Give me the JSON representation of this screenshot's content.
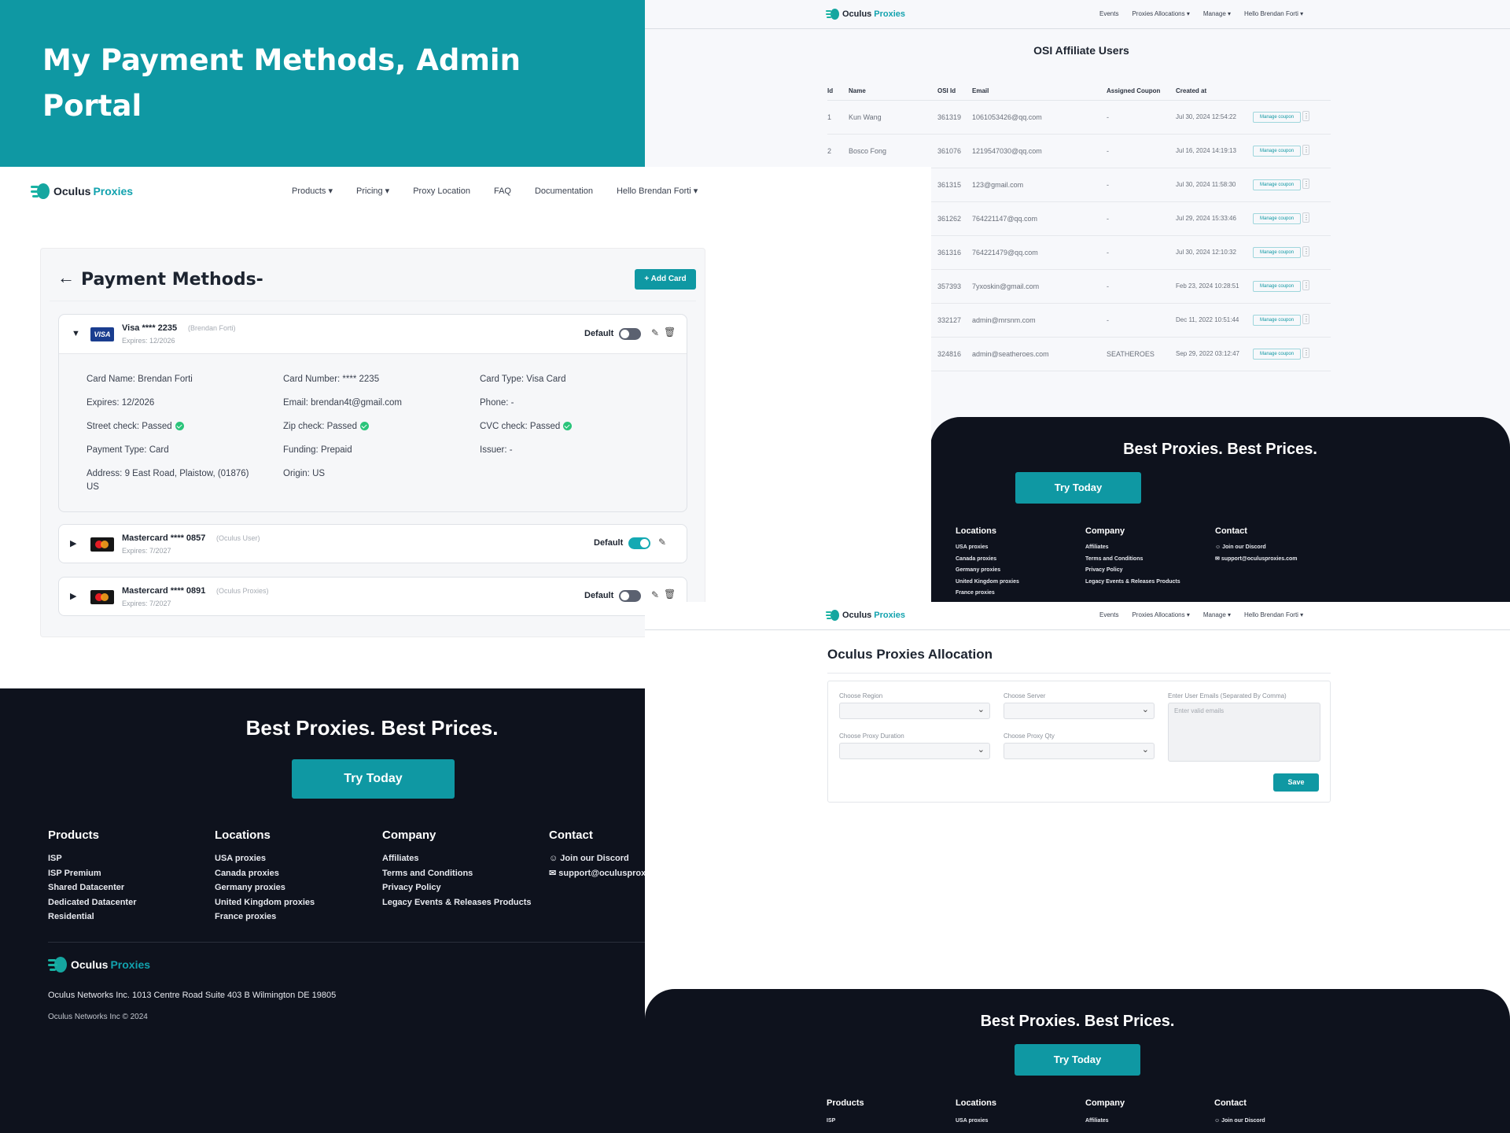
{
  "hero": {
    "title": "My Payment Methods, Admin Portal"
  },
  "brand": {
    "name_a": "Oculus ",
    "name_b": "Proxies"
  },
  "affiliate": {
    "nav": [
      "Events",
      "Proxies Allocations ▾",
      "Manage ▾",
      "Hello Brendan Forti ▾"
    ],
    "title": "OSI Affiliate Users",
    "columns": [
      "Id",
      "Name",
      "OSI Id",
      "Email",
      "Assigned Coupon",
      "Created at",
      ""
    ],
    "rows": [
      {
        "id": "1",
        "name": "Kun Wang",
        "osi": "361319",
        "email": "1061053426@qq.com",
        "coupon": "-",
        "created": "Jul 30, 2024 12:54:22"
      },
      {
        "id": "2",
        "name": "Bosco Fong",
        "osi": "361076",
        "email": "1219547030@qq.com",
        "coupon": "-",
        "created": "Jul 16, 2024 14:19:13"
      },
      {
        "id": "",
        "name": "",
        "osi": "361315",
        "email": "123@gmail.com",
        "coupon": "-",
        "created": "Jul 30, 2024 11:58:30"
      },
      {
        "id": "",
        "name": "",
        "osi": "361262",
        "email": "764221147@qq.com",
        "coupon": "-",
        "created": "Jul 29, 2024 15:33:46"
      },
      {
        "id": "",
        "name": "",
        "osi": "361316",
        "email": "764221479@qq.com",
        "coupon": "-",
        "created": "Jul 30, 2024 12:10:32"
      },
      {
        "id": "",
        "name": "",
        "osi": "357393",
        "email": "7yxoskin@gmail.com",
        "coupon": "-",
        "created": "Feb 23, 2024 10:28:51"
      },
      {
        "id": "",
        "name": "",
        "osi": "332127",
        "email": "admin@mrsnm.com",
        "coupon": "-",
        "created": "Dec 11, 2022 10:51:44"
      },
      {
        "id": "",
        "name": "",
        "osi": "324816",
        "email": "admin@seatheroes.com",
        "coupon": "SEATHEROES",
        "created": "Sep 29, 2022 03:12:47"
      }
    ],
    "manage_label": "Manage coupon",
    "footer": {
      "tagline": "Best Proxies. Best Prices.",
      "cta": "Try Today",
      "cols": [
        {
          "title": "Locations",
          "items": [
            "USA proxies",
            "Canada proxies",
            "Germany proxies",
            "United Kingdom proxies",
            "France proxies"
          ]
        },
        {
          "title": "Company",
          "items": [
            "Affiliates",
            "Terms and Conditions",
            "Privacy Policy",
            "Legacy Events & Releases Products"
          ]
        },
        {
          "title": "Contact",
          "items": [
            "Join our Discord",
            "support@oculusproxies.com"
          ]
        }
      ]
    }
  },
  "payment": {
    "nav": [
      "Products ▾",
      "Pricing ▾",
      "Proxy Location",
      "FAQ",
      "Documentation",
      "Hello Brendan Forti ▾"
    ],
    "title": "Payment Methods-",
    "add_card": "+ Add Card",
    "visa": {
      "brand": "VISA",
      "label": "Visa **** 2235",
      "owner": "(Brendan Forti)",
      "expires": "Expires: 12/2026",
      "default": "Default",
      "details": [
        [
          "Card Name: Brendan Forti",
          "Card Number: **** 2235",
          "Card Type: Visa Card"
        ],
        [
          "Expires: 12/2026",
          "Email: brendan4t@gmail.com",
          "Phone: -"
        ],
        [
          "Street check: Passed",
          "Zip check: Passed",
          "CVC check: Passed"
        ],
        [
          "Payment Type: Card",
          "Funding: Prepaid",
          "Issuer: -"
        ],
        [
          "Address: 9 East Road, Plaistow, (01876) US",
          "Origin: US",
          ""
        ]
      ]
    },
    "mc1": {
      "label": "Mastercard **** 0857",
      "owner": "(Oculus User)",
      "expires": "Expires: 7/2027",
      "default": "Default"
    },
    "mc2": {
      "label": "Mastercard **** 0891",
      "owner": "(Oculus Proxies)",
      "expires": "Expires: 7/2027",
      "default": "Default"
    }
  },
  "footer": {
    "tagline": "Best Proxies. Best Prices.",
    "cta": "Try Today",
    "cols": [
      {
        "title": "Products",
        "items": [
          "ISP",
          "ISP Premium",
          "Shared Datacenter",
          "Dedicated Datacenter",
          "Residential"
        ]
      },
      {
        "title": "Locations",
        "items": [
          "USA proxies",
          "Canada proxies",
          "Germany proxies",
          "United Kingdom proxies",
          "France proxies"
        ]
      },
      {
        "title": "Company",
        "items": [
          "Affiliates",
          "Terms and Conditions",
          "Privacy Policy",
          "Legacy Events & Releases Products"
        ]
      },
      {
        "title": "Contact",
        "items": [
          "Join our Discord",
          "support@oculusproxies.com"
        ]
      }
    ],
    "address": "Oculus Networks Inc. 1013 Centre Road Suite 403 B Wilmington DE 19805",
    "copyright": "Oculus Networks Inc © 2024"
  },
  "allocation": {
    "nav": [
      "Events",
      "Proxies Allocations ▾",
      "Manage ▾",
      "Hello Brendan Forti ▾"
    ],
    "title": "Oculus Proxies Allocation",
    "region_label": "Choose Region",
    "server_label": "Choose Server",
    "emails_label": "Enter User Emails (Separated By Comma)",
    "emails_placeholder": "Enter valid emails",
    "duration_label": "Choose Proxy Duration",
    "qty_label": "Choose Proxy Qty",
    "save": "Save",
    "footer": {
      "tagline": "Best Proxies. Best Prices.",
      "cta": "Try Today",
      "cols": [
        {
          "title": "Products",
          "items": [
            "ISP"
          ]
        },
        {
          "title": "Locations",
          "items": [
            "USA proxies"
          ]
        },
        {
          "title": "Company",
          "items": [
            "Affiliates"
          ]
        },
        {
          "title": "Contact",
          "items": [
            "Join our Discord"
          ]
        }
      ]
    }
  }
}
